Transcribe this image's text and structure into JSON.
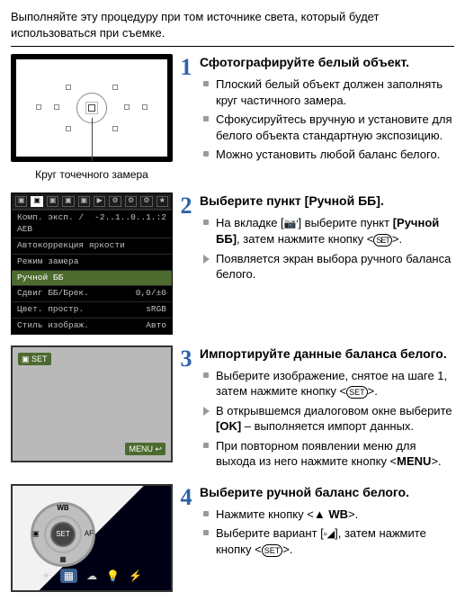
{
  "intro": "Выполняйте эту процедуру при том источнике света, который будет использоваться при съемке.",
  "step1": {
    "num": "1",
    "title": "Сфотографируйте белый объект.",
    "caption": "Круг точечного замера",
    "bullets": [
      "Плоский белый объект должен заполнять круг частичного замера.",
      "Сфокусируйтесь вручную и установите для белого объекта стандартную экспозицию.",
      "Можно установить любой баланс белого."
    ]
  },
  "step2": {
    "num": "2",
    "title_pre": "Выберите пункт ",
    "title_brk": "[Ручной ББ]",
    "title_post": ".",
    "line1_a": "На вкладке [",
    "line1_icon": "📷′",
    "line1_b": "] выберите пункт ",
    "line1_bold": "[Ручной ББ]",
    "line1_c": ", затем нажмите кнопку <",
    "line1_set": "SET",
    "line1_d": ">.",
    "line2": "Появляется экран выбора ручного баланса белого.",
    "menu": {
      "r1a": "Комп. эксп. / AEB",
      "r1b": "‑2..1..0..1.:2",
      "r2a": "Автокоррекция яркости",
      "r2b": "",
      "r3a": "Режим замера",
      "r3b": "",
      "r4a": "Ручной ББ",
      "r4b": "",
      "r5a": "Сдвиг ББ/Брек.",
      "r5b": "0,0/±0",
      "r6a": "Цвет. простр.",
      "r6b": "sRGB",
      "r7a": "Стиль изображ.",
      "r7b": "Авто"
    }
  },
  "step3": {
    "num": "3",
    "title": "Импортируйте данные баланса белого.",
    "tag": "▣ SET",
    "menub": "MENU ↩",
    "b1a": "Выберите изображение, снятое на шаге 1, затем нажмите кнопку <",
    "b1set": "SET",
    "b1b": ">.",
    "b2a": "В открывшемся диалоговом окне выберите ",
    "b2ok": "[OK]",
    "b2b": " – выполняется импорт данных.",
    "b3a": "При повторном появлении меню для выхода из него нажмите кнопку <",
    "b3menu": "MENU",
    "b3b": ">."
  },
  "step4": {
    "num": "4",
    "title": "Выберите ручной баланс белого.",
    "dial": {
      "wb": "WB",
      "af": "AF",
      "dr": "▦",
      "pic": "▣",
      "set": "SET"
    },
    "icons": {
      "a": "☀",
      "b": "▦",
      "c": "☁",
      "d": "💡",
      "e": "⚡"
    },
    "b1a": "Нажмите кнопку <",
    "b1sym": "▲ WB",
    "b1b": ">.",
    "b2a": "Выберите вариант [",
    "b2sym": "▫◢",
    "b2b": "], затем нажмите кнопку <",
    "b2set": "SET",
    "b2c": ">."
  }
}
